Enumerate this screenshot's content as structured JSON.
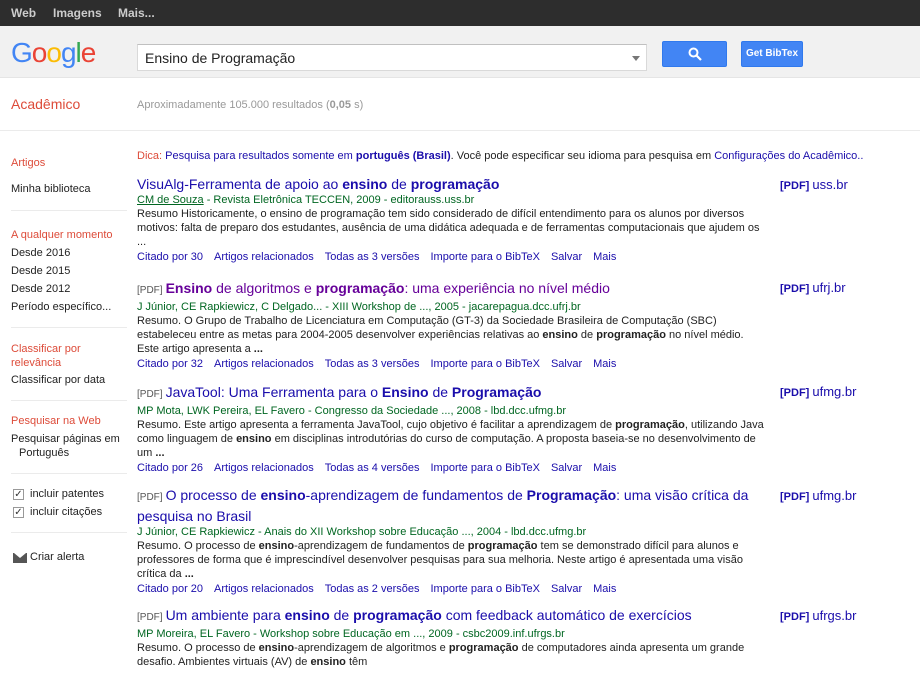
{
  "topbar": {
    "web": "Web",
    "images": "Imagens",
    "more": "Mais..."
  },
  "header": {
    "logo_letters": [
      {
        "ch": "G",
        "color": "#4285f4"
      },
      {
        "ch": "o",
        "color": "#ea4335"
      },
      {
        "ch": "o",
        "color": "#fbbc05"
      },
      {
        "ch": "g",
        "color": "#4285f4"
      },
      {
        "ch": "l",
        "color": "#34a853"
      },
      {
        "ch": "e",
        "color": "#ea4335"
      }
    ],
    "search_value": "Ensino de Programação",
    "bibtex_label": "Get BibTex",
    "search_icon": "search-icon",
    "accent": "#4285f4"
  },
  "subheader": {
    "section": "Acadêmico",
    "stats_pre": "Aproximadamente 105.000 resultados (",
    "stats_time": "0,05",
    "stats_post": " s)"
  },
  "sidebar": {
    "articles": "Artigos",
    "my_library": "Minha biblioteca",
    "any_time": "A qualquer momento",
    "since_2016": "Desde 2016",
    "since_2015": "Desde 2015",
    "since_2012": "Desde 2012",
    "custom_period": "Período específico...",
    "sort_relevance": "Classificar por relevância",
    "sort_date": "Classificar por data",
    "search_web": "Pesquisar na Web",
    "search_pt_line1": "Pesquisar páginas em",
    "search_pt_line2": "Português",
    "include_patents": "incluir patentes",
    "include_citations": "incluir citações",
    "create_alert": "Criar alerta"
  },
  "dica": {
    "label": "Dica:",
    "text1": "Pesquisa para resultados somente em",
    "lang": "português (Brasil)",
    "text2": ". Você pode especificar seu idioma para pesquisa em",
    "link": "Configurações do Acadêmico",
    "end": ".."
  },
  "results": [
    {
      "pdf_prefix": "",
      "title_html": "VisuAlg-Ferramenta de apoio ao <b>ensino</b> de <b>programação</b>",
      "meta_html": "<span class=\"ul\">CM de Souza</span> - Revista Eletrônica TECCEN, 2009 - editorauss.uss.br",
      "snippet_html": "Resumo Historicamente, o ensino de programação tem sido considerado de difícil entendimento para os alunos por diversos motivos: falta de preparo dos estudantes, ausência de uma didática adequada e de ferramentas computacionais que ajudem os ...",
      "cited": "Citado por 30",
      "related": "Artigos relacionados",
      "versions": "Todas as 3 versões",
      "import": "Importe para o BibTeX",
      "save": "Salvar",
      "more": "Mais",
      "side_tag": "[PDF]",
      "side_domain": "uss.br"
    },
    {
      "pdf_prefix": "[PDF]",
      "title_html": "<span class=\"visited\"><b>Ensino</b> de algoritmos e <b>programação</b>: uma experiência no nível médio</span>",
      "meta_html": "J Júnior, CE Rapkiewicz, C Delgado... - XIII Workshop de ..., 2005 - jacarepagua.dcc.ufrj.br",
      "snippet_html": "Resumo. O Grupo de Trabalho de Licenciatura em Computação (GT-3) da Sociedade Brasileira de Computação (SBC) estabeleceu entre as metas para 2004-2005 desenvolver experiências relativas ao <b>ensino</b> de <b>programação</b> no nível médio. Este artigo apresenta a <b>...</b>",
      "cited": "Citado por 32",
      "related": "Artigos relacionados",
      "versions": "Todas as 3 versões",
      "import": "Importe para o BibTeX",
      "save": "Salvar",
      "more": "Mais",
      "side_tag": "[PDF]",
      "side_domain": "ufrj.br"
    },
    {
      "pdf_prefix": "[PDF]",
      "title_html": "JavaTool: Uma Ferramenta para o <b>Ensino</b> de <b>Programação</b>",
      "meta_html": "MP Mota, LWK Pereira, EL Favero - Congresso da Sociedade ..., 2008 - lbd.dcc.ufmg.br",
      "snippet_html": "Resumo. Este artigo apresenta a ferramenta JavaTool, cujo objetivo é facilitar a aprendizagem de <b>programação</b>, utilizando Java como linguagem de <b>ensino</b> em disciplinas introdutórias do curso de computação. A proposta baseia-se no desenvolvimento de um <b>...</b>",
      "cited": "Citado por 26",
      "related": "Artigos relacionados",
      "versions": "Todas as 4 versões",
      "import": "Importe para o BibTeX",
      "save": "Salvar",
      "more": "Mais",
      "side_tag": "[PDF]",
      "side_domain": "ufmg.br"
    },
    {
      "pdf_prefix": "[PDF]",
      "title_html": "O processo de <b>ensino</b>-aprendizagem de fundamentos de <b>Programação</b>: uma visão crítica da pesquisa no Brasil",
      "meta_html": "J Júnior, CE Rapkiewicz - Anais do XII Workshop sobre Educação ..., 2004 - lbd.dcc.ufmg.br",
      "snippet_html": "Resumo. O processo de <b>ensino</b>-aprendizagem de fundamentos de <b>programação</b> tem se demonstrado difícil para alunos e professores de forma que é imprescindível desenvolver pesquisas para sua melhoria. Neste artigo é apresentada uma visão crítica da <b>...</b>",
      "cited": "Citado por 20",
      "related": "Artigos relacionados",
      "versions": "Todas as 2 versões",
      "import": "Importe para o BibTeX",
      "save": "Salvar",
      "more": "Mais",
      "side_tag": "[PDF]",
      "side_domain": "ufmg.br"
    },
    {
      "pdf_prefix": "[PDF]",
      "title_html": "Um ambiente para <b>ensino</b> de <b>programação</b> com feedback automático de exercícios",
      "meta_html": "MP Moreira, EL Favero - Workshop sobre Educação em ..., 2009 - csbc2009.inf.ufrgs.br",
      "snippet_html": "Resumo. O processo de <b>ensino</b>-aprendizagem de algoritmos e <b>programação</b> de computadores ainda apresenta um grande desafio. Ambientes virtuais (AV) de <b>ensino</b> têm",
      "cited": "",
      "related": "",
      "versions": "",
      "import": "",
      "save": "",
      "more": "",
      "side_tag": "[PDF]",
      "side_domain": "ufrgs.br"
    }
  ]
}
